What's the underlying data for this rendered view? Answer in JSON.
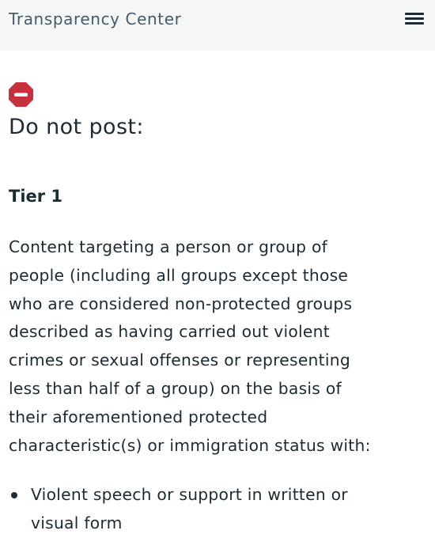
{
  "header": {
    "brand": "Transparency Center",
    "menu_icon": "hamburger-menu-icon"
  },
  "section": {
    "status_icon": "prohibited-icon",
    "status_color": "#c8313c",
    "heading": "Do not post:",
    "tier": "Tier 1",
    "description_lines": [
      "Content targeting a person or group of",
      "people (including all groups except those",
      "who are considered non-protected groups",
      "described as having carried out violent",
      "crimes or sexual offenses or representing",
      "less than half of a group) on the basis of",
      "their aforementioned protected",
      "characteristic(s) or immigration status with:"
    ],
    "list_items": [
      {
        "lines": [
          "Violent speech or support in written or",
          "visual form"
        ]
      }
    ]
  }
}
